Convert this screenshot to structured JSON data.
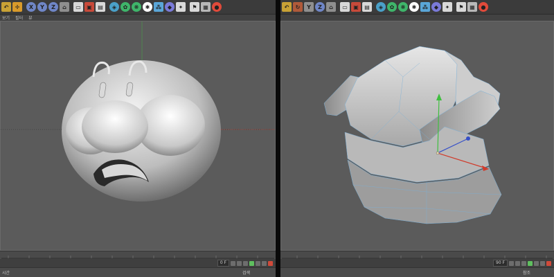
{
  "toolbar_icons": [
    "undo-icon",
    "move-icon",
    "x-axis-lock",
    "y-axis-lock",
    "z-axis-lock",
    "world-coord-icon",
    "render-view-icon",
    "render-picture-icon",
    "render-settings-icon",
    "cube-primitive-icon",
    "subdivision-icon",
    "spline-pen-icon",
    "array-icon",
    "deformer-icon",
    "environment-icon",
    "camera-icon",
    "light-icon",
    "tag-icon",
    "record-icon"
  ],
  "toolbar_letters": {
    "x": "X",
    "y": "Y",
    "z": "Z"
  },
  "left_panel": {
    "menu": [
      "보기",
      "필터",
      "뷰"
    ],
    "frame_value": "0 F",
    "status_left": "시간",
    "status_right": "검색"
  },
  "right_panel": {
    "menu": [],
    "frame_value": "90 F",
    "status_left": "",
    "status_right": "참조"
  },
  "colors": {
    "viewport_bg": "#5b5b5b",
    "y_axis": "#3fbf3f",
    "x_axis": "#d03b2b",
    "z_axis": "#3650c8",
    "mesh_edge": "#7ab0d8"
  }
}
